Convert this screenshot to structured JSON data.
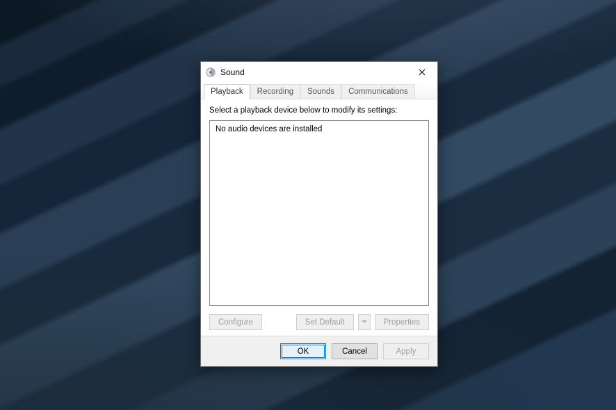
{
  "window": {
    "title": "Sound"
  },
  "tabs": [
    {
      "label": "Playback",
      "active": true
    },
    {
      "label": "Recording",
      "active": false
    },
    {
      "label": "Sounds",
      "active": false
    },
    {
      "label": "Communications",
      "active": false
    }
  ],
  "instruction": "Select a playback device below to modify its settings:",
  "devicelist": {
    "empty_message": "No audio devices are installed"
  },
  "buttons": {
    "configure": "Configure",
    "set_default": "Set Default",
    "properties": "Properties",
    "ok": "OK",
    "cancel": "Cancel",
    "apply": "Apply"
  }
}
